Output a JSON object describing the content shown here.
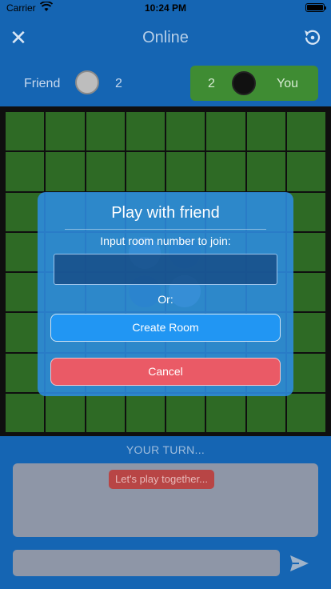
{
  "status_bar": {
    "carrier": "Carrier",
    "time": "10:24 PM"
  },
  "nav": {
    "title": "Online",
    "close_icon": "close-icon",
    "reset_icon": "restart-icon"
  },
  "players": {
    "left": {
      "name": "Friend",
      "score": "2",
      "disc_color": "white"
    },
    "right": {
      "name": "You",
      "score": "2",
      "disc_color": "black",
      "highlight": "#3f8c33"
    }
  },
  "board": {
    "rows": 8,
    "cols": 8,
    "cell_color": "#2e6a25"
  },
  "modal": {
    "title": "Play with friend",
    "label": "Input room number to join:",
    "room_input_value": "",
    "or_text": "Or:",
    "create_label": "Create Room",
    "cancel_label": "Cancel"
  },
  "turn_text": "YOUR TURN...",
  "chat": {
    "messages": [
      "Let's play together..."
    ],
    "input_value": "",
    "send_icon": "send-icon"
  },
  "colors": {
    "background": "#1565b3",
    "accent_green": "#3f8c33",
    "cancel_red": "#ea5a66",
    "create_blue": "#2196f3"
  }
}
